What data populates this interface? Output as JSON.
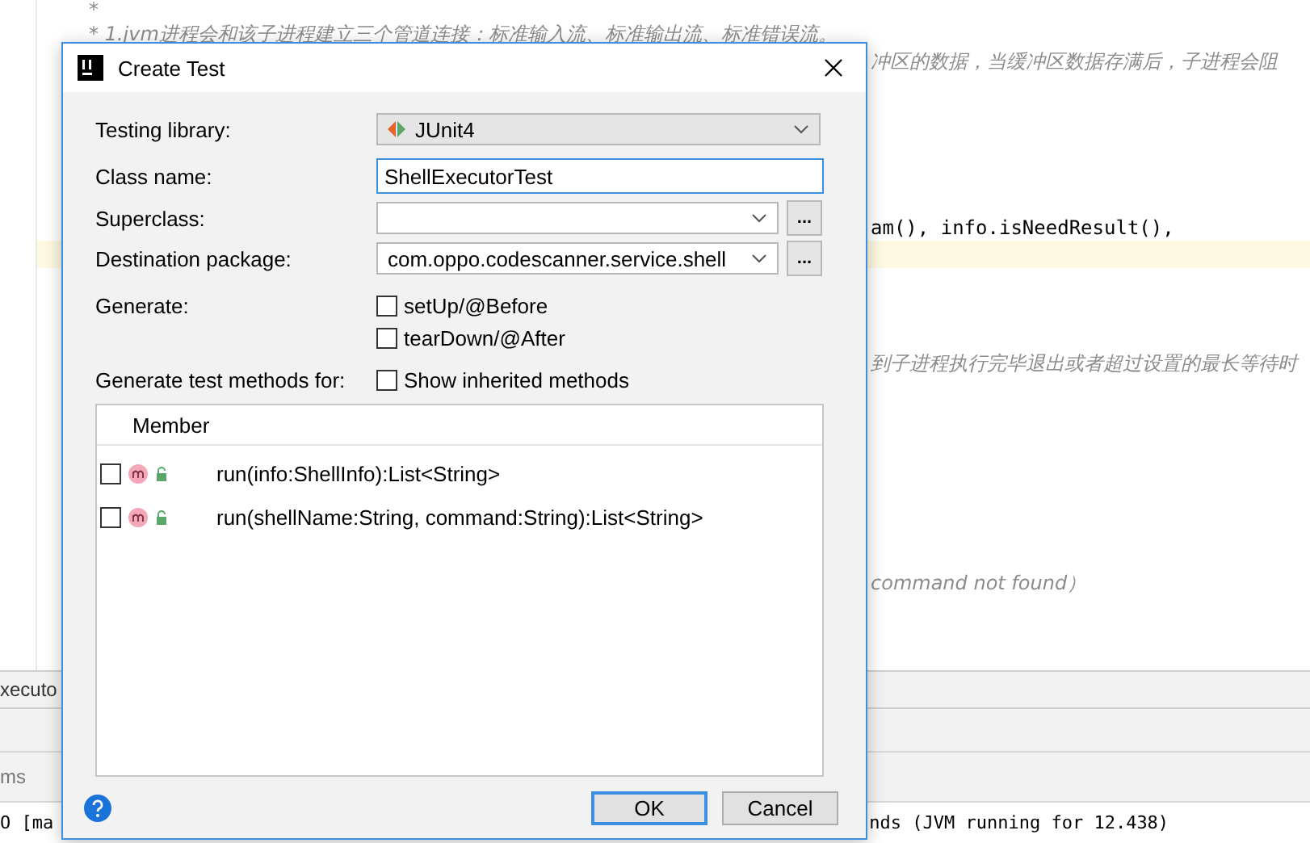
{
  "editor": {
    "lines": [
      {
        "text": "*",
        "kind": "comment"
      },
      {
        "text": "* 1.jvm进程会和该子进程建立三个管道连接：标准输入流、标准输出流、标准错误流。",
        "kind": "comment"
      },
      {
        "text": "冲区的数据，当缓冲区数据存满后，子进程会阻",
        "kind": "comment"
      },
      {
        "text": "am(), info.isNeedResult(),",
        "kind": "code"
      },
      {
        "text": "到子进程执行完毕退出或者超过设置的最长等待时",
        "kind": "comment"
      },
      {
        "text": "command not found）",
        "kind": "comment"
      }
    ]
  },
  "tool_window": {
    "tab": "xecuto",
    "filter": "ms",
    "console": [
      "O [ma",
      "nds (JVM running for 12.438)"
    ]
  },
  "dialog": {
    "title": "Create Test",
    "testing_library": {
      "label": "Testing library:",
      "value": "JUnit4"
    },
    "class_name": {
      "label": "Class name:",
      "value": "ShellExecutorTest"
    },
    "superclass": {
      "label": "Superclass:",
      "browse": "..."
    },
    "destination_package": {
      "label": "Destination package:",
      "value": "com.oppo.codescanner.service.shell",
      "browse": "..."
    },
    "generate": {
      "label": "Generate:",
      "options": [
        {
          "label": "setUp/@Before",
          "checked": false
        },
        {
          "label": "tearDown/@After",
          "checked": false
        }
      ]
    },
    "methods_for": {
      "label": "Generate test methods for:",
      "show_inherited": {
        "label": "Show inherited methods",
        "checked": false
      }
    },
    "members": {
      "column": "Member",
      "rows": [
        {
          "signature": "run(info:ShellInfo):List<String>",
          "checked": false
        },
        {
          "signature": "run(shellName:String, command:String):List<String>",
          "checked": false
        }
      ]
    },
    "buttons": [
      {
        "label": "OK",
        "default": true
      },
      {
        "label": "Cancel",
        "default": false
      }
    ]
  }
}
